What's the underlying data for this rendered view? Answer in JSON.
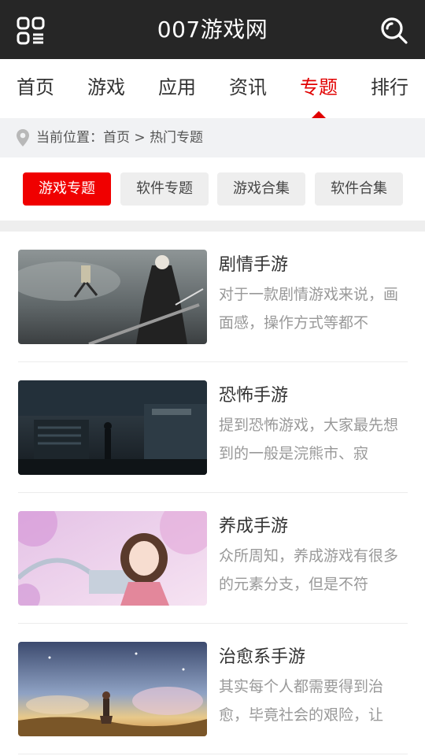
{
  "header": {
    "title": "007游戏网",
    "menu_icon": "grid-menu-icon",
    "search_icon": "search-icon"
  },
  "nav": {
    "items": [
      {
        "label": "首页",
        "active": false
      },
      {
        "label": "游戏",
        "active": false
      },
      {
        "label": "应用",
        "active": false
      },
      {
        "label": "资讯",
        "active": false
      },
      {
        "label": "专题",
        "active": true
      },
      {
        "label": "排行",
        "active": false
      }
    ],
    "active_color": "#e10000"
  },
  "breadcrumb": {
    "prefix": "当前位置：",
    "home": "首页",
    "separator": " > ",
    "current": "热门专题",
    "icon": "location-pin-icon"
  },
  "filters": {
    "tabs": [
      {
        "label": "游戏专题",
        "active": true
      },
      {
        "label": "软件专题",
        "active": false
      },
      {
        "label": "游戏合集",
        "active": false
      },
      {
        "label": "软件合集",
        "active": false
      }
    ],
    "active_color": "#f00000"
  },
  "topics": [
    {
      "title": "剧情手游",
      "desc": "对于一款剧情游戏来说，画面感，操作方式等都不"
    },
    {
      "title": "恐怖手游",
      "desc": "提到恐怖游戏，大家最先想到的一般是浣熊市、寂"
    },
    {
      "title": "养成手游",
      "desc": "众所周知，养成游戏有很多的元素分支，但是不符"
    },
    {
      "title": "治愈系手游",
      "desc": "其实每个人都需要得到治愈，毕竟社会的艰险，让"
    }
  ]
}
